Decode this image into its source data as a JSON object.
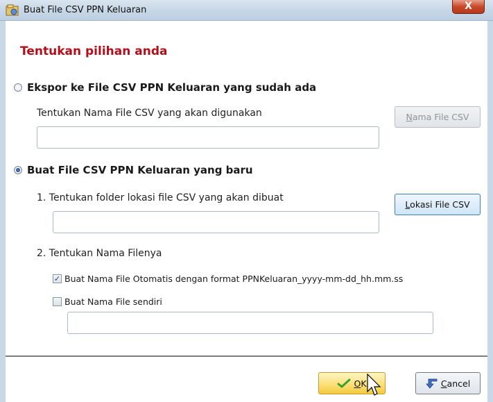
{
  "window": {
    "title": "Buat File CSV PPN Keluaran",
    "close_label": "X"
  },
  "heading": "Tentukan pilihan anda",
  "option_existing": {
    "label": "Ekspor ke  File CSV PPN Keluaran yang sudah ada",
    "selected": false,
    "prompt": "Tentukan Nama File  CSV yang akan digunakan",
    "input_value": "",
    "button": {
      "mnemonic": "N",
      "rest": "ama File CSV",
      "enabled": false
    }
  },
  "option_new": {
    "label": "Buat File CSV PPN Keluaran yang baru",
    "selected": true,
    "step1": "1. Tentukan folder lokasi file  CSV yang akan dibuat",
    "folder_value": "",
    "folder_button": {
      "mnemonic": "L",
      "rest": "okasi File CSV"
    },
    "step2": "2. Tentukan Nama Filenya",
    "auto_name": {
      "label": "Buat Nama File Otomatis dengan format PPNKeluaran_yyyy-mm-dd_hh.mm.ss",
      "checked": true
    },
    "custom_name": {
      "label": "Buat Nama File sendiri",
      "checked": false,
      "value": ""
    }
  },
  "footer": {
    "ok": {
      "mnemonic": "O",
      "rest": "K"
    },
    "cancel": {
      "mnemonic": "C",
      "rest": "ancel"
    }
  },
  "colors": {
    "heading": "#b30f1b",
    "ok_button": "#f4c93d",
    "title_bar": "#c5d6e6",
    "close_button": "#c74a2b"
  },
  "icons": [
    "app-icon",
    "close-icon",
    "radio-icon",
    "checkbox-icon",
    "check-icon",
    "back-arrow-icon",
    "cursor-icon"
  ]
}
